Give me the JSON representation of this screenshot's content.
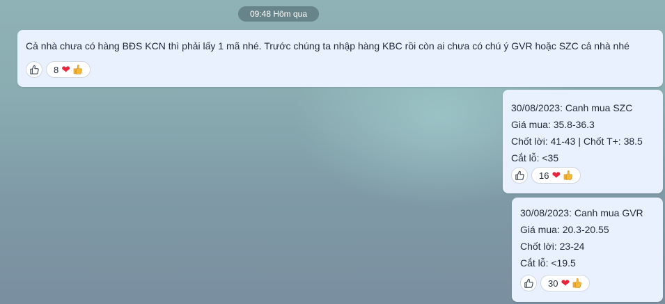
{
  "timestamp": "09:48 Hôm qua",
  "messages": [
    {
      "text": "Cả nhà chưa có hàng BĐS KCN thì phải lấy 1 mã nhé. Trước chúng ta nhập hàng KBC rồi còn ai chưa có chú ý GVR hoặc SZC cả nhà nhé",
      "reaction_count": "8",
      "reactions": [
        "heart-emoji",
        "thumbs-up-emoji"
      ]
    },
    {
      "lines": [
        "30/08/2023: Canh mua SZC",
        "Giá mua: 35.8-36.3",
        "Chốt lời: 41-43 | Chốt T+: 38.5",
        "Cắt lỗ: <35"
      ],
      "reaction_count": "16",
      "reactions": [
        "heart-emoji",
        "thumbs-up-emoji"
      ]
    },
    {
      "lines": [
        "30/08/2023: Canh mua GVR",
        "Giá mua: 20.3-20.55",
        "Chốt lời: 23-24",
        "Cắt lỗ: <19.5"
      ],
      "reaction_count": "30",
      "reactions": [
        "heart-emoji",
        "thumbs-up-emoji"
      ]
    }
  ],
  "colors": {
    "bubble": "#e9f1fe",
    "heart": "#e8253a",
    "thumb": "#f5b93a"
  }
}
